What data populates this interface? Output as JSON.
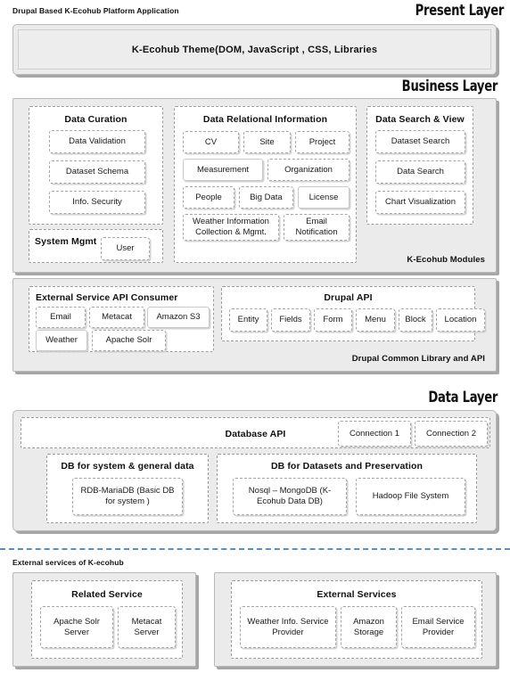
{
  "app_caption": "Drupal Based K-Ecohub Platform Application",
  "layers": {
    "present": "Present Layer",
    "business": "Business Layer",
    "data": "Data Layer"
  },
  "present_layer": {
    "theme_bar": "K-Ecohub  Theme(DOM,  JavaScript , CSS, Libraries"
  },
  "business_layer": {
    "modules_tag": "K-Ecohub Modules",
    "common_tag": "Drupal Common Library and API",
    "data_curation": {
      "title": "Data Curation",
      "items": [
        "Data Validation",
        "Dataset Schema",
        "Info. Security"
      ]
    },
    "system_mgmt": {
      "title": "System Mgmt",
      "items": [
        "User"
      ]
    },
    "data_relational": {
      "title": "Data Relational Information",
      "row1": [
        "CV",
        "Site",
        "Project"
      ],
      "row2": [
        "Measurement",
        "Organization"
      ],
      "row3": [
        "People",
        "Big Data",
        "License"
      ],
      "row4": [
        "Weather Information Collection & Mgmt.",
        "Email Notification"
      ]
    },
    "data_search_view": {
      "title": "Data Search & View",
      "items": [
        "Dataset Search",
        "Data Search",
        "Chart Visualization"
      ]
    },
    "external_api_consumer": {
      "title": "External Service API Consumer",
      "row1": [
        "Email",
        "Metacat",
        "Amazon  S3"
      ],
      "row2": [
        "Weather",
        "Apache  Solr"
      ]
    },
    "drupal_api": {
      "title": "Drupal API",
      "items": [
        "Entity",
        "Fields",
        "Form",
        "Menu",
        "Block",
        "Location"
      ]
    }
  },
  "data_layer": {
    "database_api": {
      "title": "Database API",
      "connections": [
        "Connection 1",
        "Connection 2"
      ]
    },
    "db_system": {
      "title": "DB for system & general data",
      "items": [
        "RDB-MariaDB (Basic DB for system )"
      ]
    },
    "db_datasets": {
      "title": "DB for Datasets and Preservation",
      "items": [
        "Nosql – MongoDB (K-Ecohub Data DB)",
        "Hadoop File System"
      ]
    }
  },
  "external_section": {
    "caption": "External services of K-ecohub",
    "related_service": {
      "title": "Related Service",
      "items": [
        "Apache  Solr Server",
        "Metacat Server"
      ]
    },
    "external_services": {
      "title": "External Services",
      "items": [
        "Weather Info. Service Provider",
        "Amazon Storage",
        "Email Service Provider"
      ]
    }
  },
  "colors": {
    "shell_fill": "#ebebeb",
    "node_fill": "#ffffff",
    "divider": "#5b8fbf",
    "shadow": "#969696"
  }
}
